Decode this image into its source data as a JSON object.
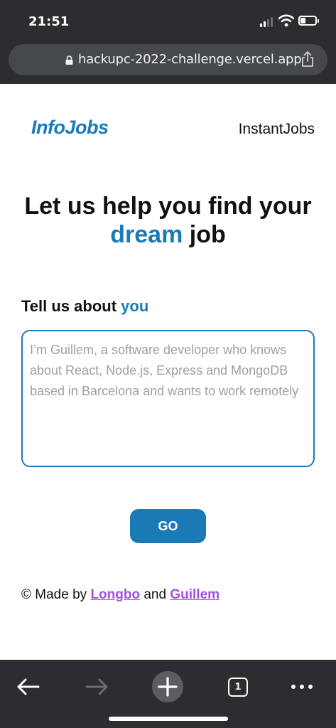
{
  "status_bar": {
    "time": "21:51"
  },
  "browser": {
    "url": "hackupc-2022-challenge.vercel.app"
  },
  "header": {
    "logo": "InfoJobs",
    "brand": "InstantJobs"
  },
  "hero": {
    "line1": "Let us help you find your",
    "accent_word": "dream",
    "line2_rest": "job"
  },
  "form": {
    "label_prefix": "Tell us about",
    "label_accent": "you",
    "placeholder": "I’m Guillem, a software developer who knows about React, Node.js, Express and MongoDB based in Barcelona and wants to work remotely",
    "value": "",
    "submit_label": "GO"
  },
  "footer": {
    "prefix": "© Made by",
    "author1": "Longbo",
    "joiner": "and",
    "author2": "Guillem"
  },
  "toolbar": {
    "tab_count": "1"
  },
  "colors": {
    "accent": "#1a7ab6",
    "link": "#a24fe0",
    "chrome": "#2b2d30"
  }
}
